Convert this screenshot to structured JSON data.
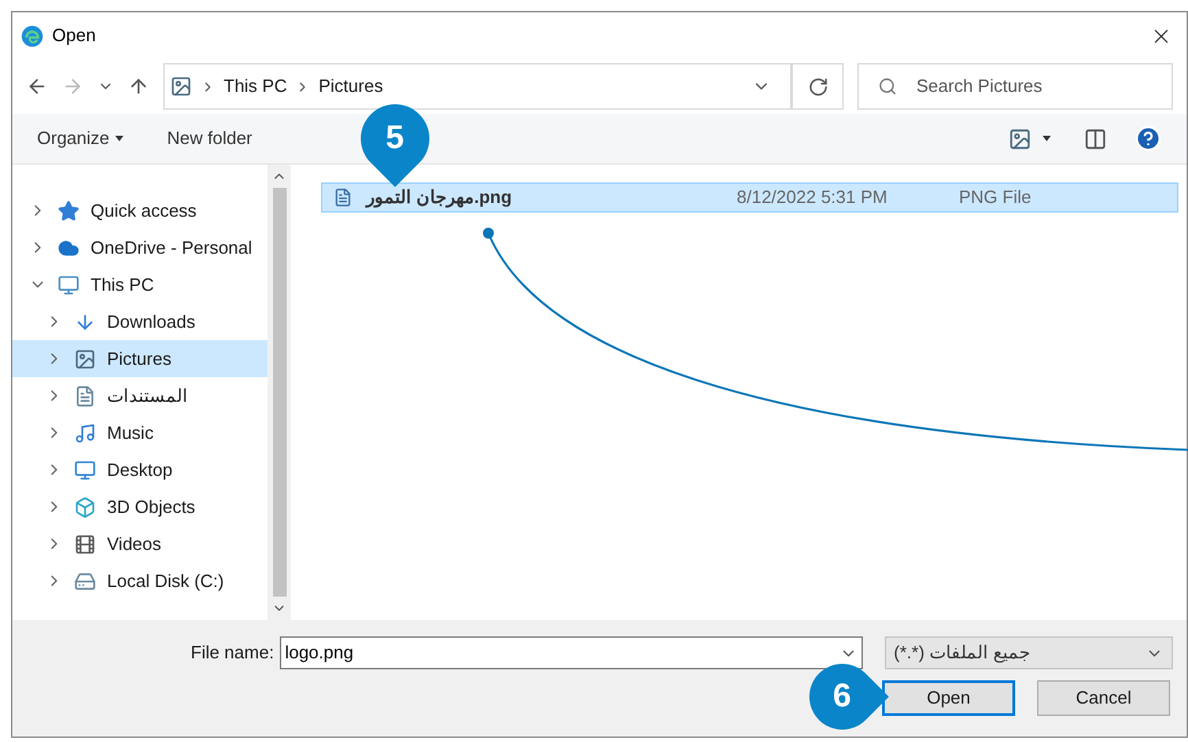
{
  "window": {
    "title": "Open"
  },
  "breadcrumb": [
    "This PC",
    "Pictures"
  ],
  "search": {
    "placeholder": "Search Pictures"
  },
  "toolbar": {
    "organize": "Organize",
    "new_folder": "New folder"
  },
  "nav_tree": [
    {
      "label": "Quick access",
      "kind": "star",
      "expanded": false,
      "selected": false
    },
    {
      "label": "OneDrive - Personal",
      "kind": "cloud",
      "expanded": false,
      "selected": false
    },
    {
      "label": "This PC",
      "kind": "computer",
      "expanded": true,
      "selected": false,
      "children": [
        {
          "label": "Downloads",
          "kind": "download",
          "expanded": false,
          "selected": false
        },
        {
          "label": "Pictures",
          "kind": "pictures",
          "expanded": false,
          "selected": true
        },
        {
          "label": "المستندات",
          "kind": "documents",
          "expanded": false,
          "selected": false
        },
        {
          "label": "Music",
          "kind": "music",
          "expanded": false,
          "selected": false
        },
        {
          "label": "Desktop",
          "kind": "desktop",
          "expanded": false,
          "selected": false
        },
        {
          "label": "3D Objects",
          "kind": "cube",
          "expanded": false,
          "selected": false
        },
        {
          "label": "Videos",
          "kind": "videos",
          "expanded": false,
          "selected": false
        },
        {
          "label": "Local Disk (C:)",
          "kind": "disk",
          "expanded": false,
          "selected": false
        }
      ]
    }
  ],
  "files": [
    {
      "name": "مهرجان التمور.png",
      "date": "8/12/2022 5:31 PM",
      "type": "PNG File",
      "selected": true
    }
  ],
  "file_name": {
    "label": "File name:",
    "value": "logo.png"
  },
  "file_type": {
    "value": "جميع الملفات (*.*)"
  },
  "buttons": [
    {
      "label": "Open",
      "default": true
    },
    {
      "label": "Cancel",
      "default": false
    }
  ],
  "callouts": [
    "5",
    "6"
  ]
}
